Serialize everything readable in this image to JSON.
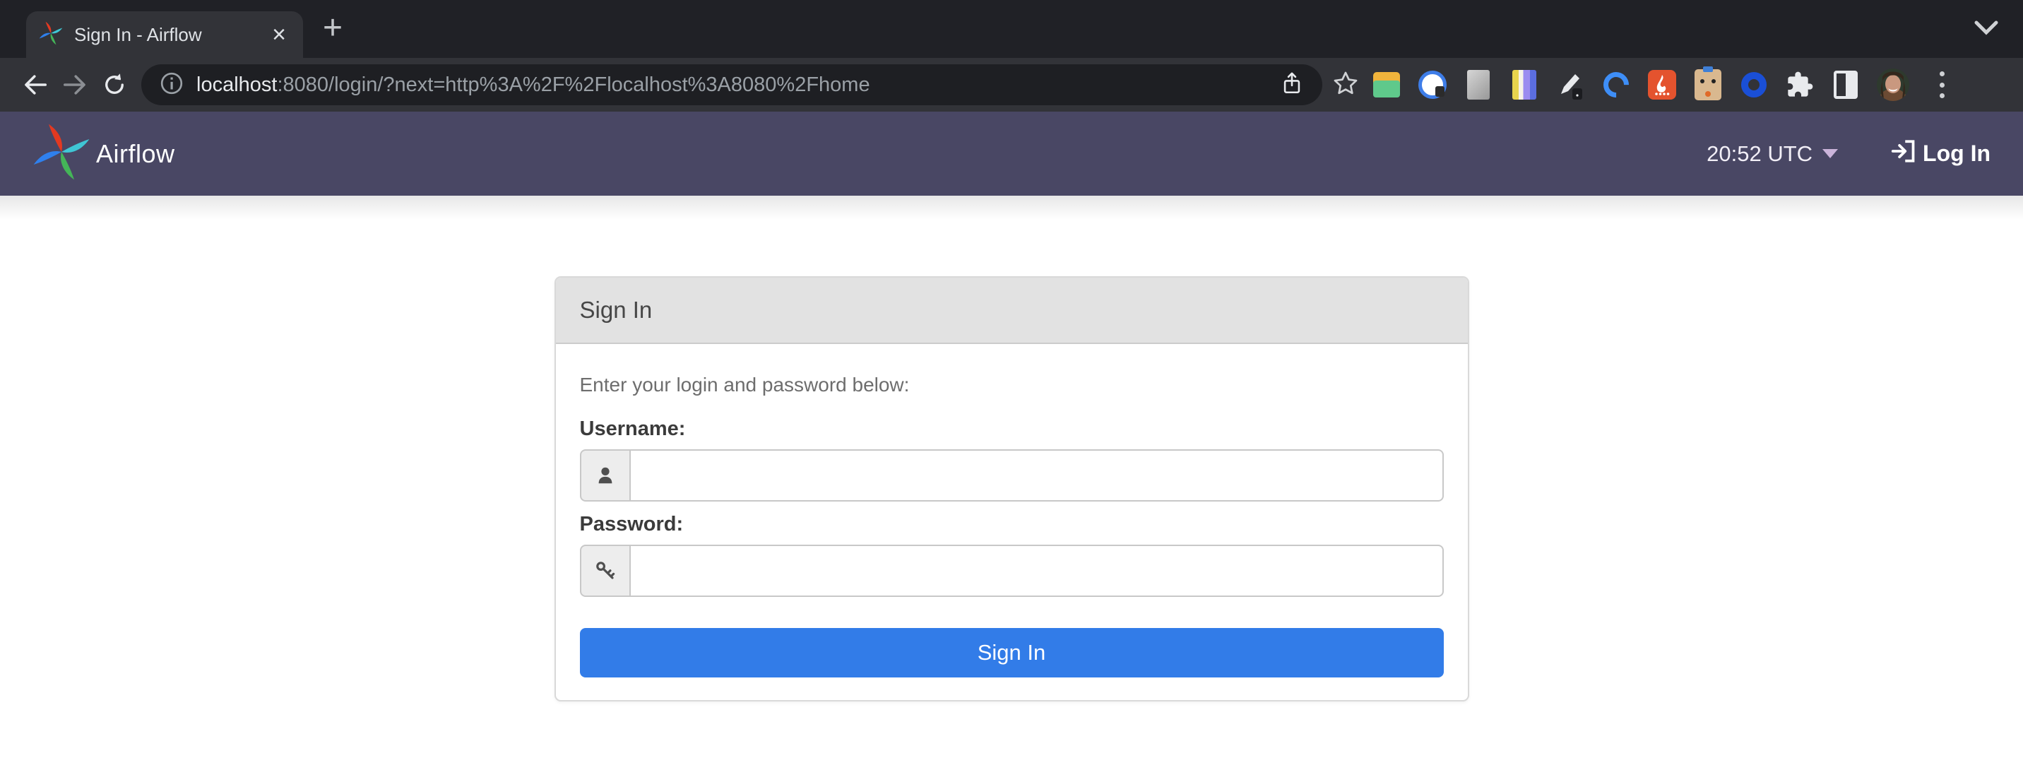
{
  "browser": {
    "tab_title": "Sign In - Airflow",
    "close_glyph": "×",
    "new_tab_glyph": "+",
    "url_host": "localhost",
    "url_rest": ":8080/login/?next=http%3A%2F%2Flocalhost%3A8080%2Fhome"
  },
  "navbar": {
    "brand": "Airflow",
    "clock": "20:52 UTC",
    "login_label": "Log In"
  },
  "signin": {
    "panel_title": "Sign In",
    "instructions": "Enter your login and password below:",
    "username_label": "Username:",
    "username_value": "",
    "password_label": "Password:",
    "password_value": "",
    "submit_label": "Sign In"
  },
  "icons": {
    "tab_favicon": "airflow-pinwheel",
    "toolbar": [
      "back-arrow",
      "forward-arrow",
      "reload",
      "page-info",
      "share",
      "bookmark-star"
    ],
    "extensions": [
      "folder",
      "onepassword",
      "gray-card",
      "color-columns",
      "pen",
      "blue-c",
      "fire",
      "cat-box",
      "blue-ring",
      "puzzle-extensions",
      "side-panel",
      "profile-avatar",
      "kebab-menu"
    ],
    "form": [
      "user-silhouette",
      "key"
    ],
    "navbar": [
      "airflow-pinwheel-logo",
      "caret-down",
      "sign-in-arrow-bracket"
    ]
  },
  "colors": {
    "navbar_bg": "#494764",
    "primary_button": "#327ce8",
    "panel_header_bg": "#e2e2e2",
    "tab_strip_bg": "#202126",
    "toolbar_bg": "#323338",
    "urlbar_bg": "#1e1f23"
  }
}
